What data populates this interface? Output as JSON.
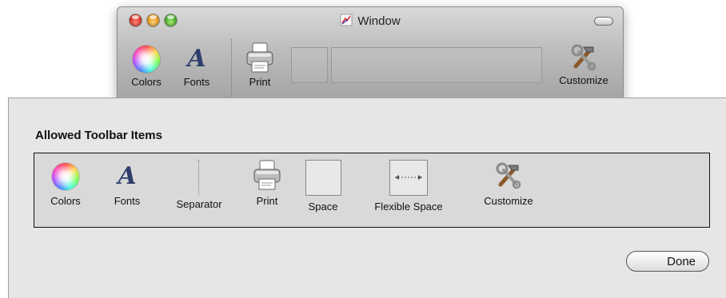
{
  "window": {
    "title": "Window",
    "toolbar": {
      "colors_label": "Colors",
      "fonts_label": "Fonts",
      "print_label": "Print",
      "customize_label": "Customize"
    }
  },
  "sheet": {
    "title": "Allowed Toolbar Items",
    "items": {
      "colors": "Colors",
      "fonts": "Fonts",
      "separator": "Separator",
      "print": "Print",
      "space": "Space",
      "flexible_space": "Flexible Space",
      "customize": "Customize"
    },
    "done_label": "Done"
  },
  "icons": {
    "fonts_glyph": "A"
  },
  "colors": {
    "close": "#d9261c",
    "minimize": "#e08a0c",
    "zoom": "#3a9e1e",
    "font_icon": "#2e3e6a"
  }
}
